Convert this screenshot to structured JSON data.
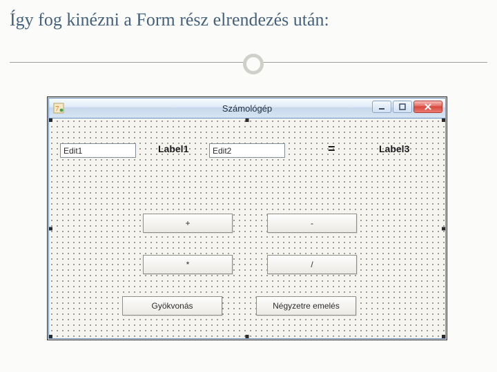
{
  "slide": {
    "heading": "Így fog kinézni a Form rész elrendezés után:"
  },
  "form": {
    "title": "Számológép",
    "edit1": "Edit1",
    "edit2": "Edit2",
    "label1": "Label1",
    "equals": "=",
    "label3": "Label3",
    "buttons": {
      "plus": "+",
      "minus": "-",
      "multiply": "*",
      "divide": "/",
      "sqrt": "Gyökvonás",
      "square": "Négyzetre emelés"
    },
    "win": {
      "minimize": "minimize-icon",
      "maximize": "maximize-icon",
      "close": "close-icon"
    }
  }
}
